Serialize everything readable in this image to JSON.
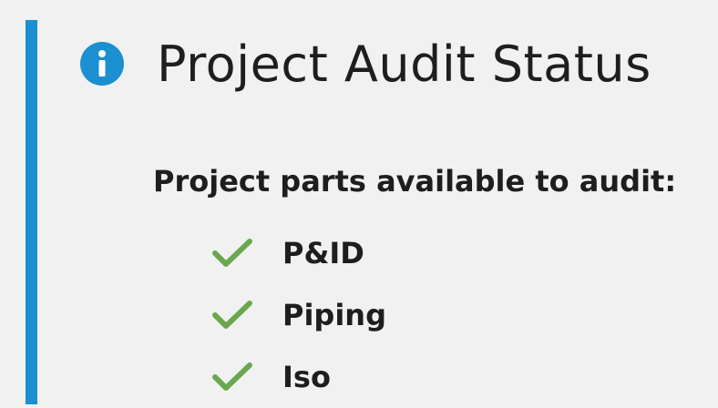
{
  "panel": {
    "title": "Project Audit Status",
    "info_icon": "info-icon",
    "accent_color": "#1c8fd0"
  },
  "parts": {
    "heading": "Project parts available to audit:",
    "check_icon": "check-icon",
    "check_color": "#6aa84f",
    "items": [
      {
        "label": "P&ID",
        "available": true
      },
      {
        "label": "Piping",
        "available": true
      },
      {
        "label": "Iso",
        "available": true
      }
    ]
  }
}
